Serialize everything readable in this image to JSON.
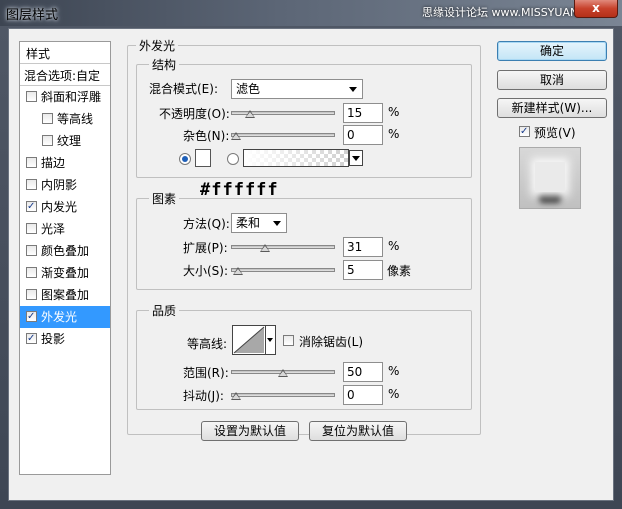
{
  "window": {
    "title": "图层样式",
    "watermark": "思缘设计论坛 www.MISSYUAN.COM",
    "close": "x"
  },
  "style_list": {
    "header": "样式",
    "blend_options": "混合选项:自定",
    "items": [
      {
        "label": "斜面和浮雕",
        "checked": false,
        "sub": false,
        "active": false
      },
      {
        "label": "等高线",
        "checked": false,
        "sub": true,
        "active": false
      },
      {
        "label": "纹理",
        "checked": false,
        "sub": true,
        "active": false
      },
      {
        "label": "描边",
        "checked": false,
        "sub": false,
        "active": false
      },
      {
        "label": "内阴影",
        "checked": false,
        "sub": false,
        "active": false
      },
      {
        "label": "内发光",
        "checked": true,
        "sub": false,
        "active": false
      },
      {
        "label": "光泽",
        "checked": false,
        "sub": false,
        "active": false
      },
      {
        "label": "颜色叠加",
        "checked": false,
        "sub": false,
        "active": false
      },
      {
        "label": "渐变叠加",
        "checked": false,
        "sub": false,
        "active": false
      },
      {
        "label": "图案叠加",
        "checked": false,
        "sub": false,
        "active": false
      },
      {
        "label": "外发光",
        "checked": true,
        "sub": false,
        "active": true
      },
      {
        "label": "投影",
        "checked": true,
        "sub": false,
        "active": false
      }
    ]
  },
  "panel": {
    "title": "外发光",
    "structure": {
      "label": "结构",
      "blend_mode_label": "混合模式(E):",
      "blend_mode_value": "滤色",
      "opacity_label": "不透明度(O):",
      "opacity_value": "15",
      "opacity_unit": "%",
      "opacity_fraction": 0.15,
      "noise_label": "杂色(N):",
      "noise_value": "0",
      "noise_unit": "%",
      "noise_fraction": 0.0,
      "color_hex": "#ffffff"
    },
    "elements": {
      "label": "图素",
      "technique_label": "方法(Q):",
      "technique_value": "柔和",
      "spread_label": "扩展(P):",
      "spread_value": "31",
      "spread_unit": "%",
      "spread_fraction": 0.31,
      "size_label": "大小(S):",
      "size_value": "5",
      "size_unit": "像素",
      "size_fraction": 0.02
    },
    "quality": {
      "label": "品质",
      "contour_label": "等高线:",
      "antialias_label": "消除锯齿(L)",
      "range_label": "范围(R):",
      "range_value": "50",
      "range_unit": "%",
      "range_fraction": 0.5,
      "jitter_label": "抖动(J):",
      "jitter_value": "0",
      "jitter_unit": "%",
      "jitter_fraction": 0.0
    },
    "make_default": "设置为默认值",
    "reset_default": "复位为默认值"
  },
  "buttons": {
    "ok": "确定",
    "cancel": "取消",
    "new_style": "新建样式(W)...",
    "preview_label": "预览(V)"
  },
  "colors": {
    "selection": "#3399ff",
    "glow_color": "#ffffff"
  }
}
